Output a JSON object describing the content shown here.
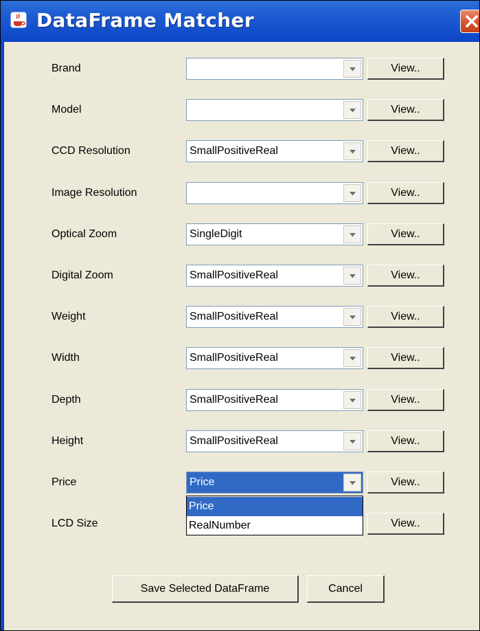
{
  "window": {
    "title": "DataFrame Matcher",
    "icon": "java-cup-icon",
    "close_icon": "close-x-icon"
  },
  "view_label": "View..",
  "fields": [
    {
      "label": "Brand",
      "value": ""
    },
    {
      "label": "Model",
      "value": ""
    },
    {
      "label": "CCD Resolution",
      "value": "SmallPositiveReal"
    },
    {
      "label": "Image Resolution",
      "value": ""
    },
    {
      "label": "Optical Zoom",
      "value": "SingleDigit"
    },
    {
      "label": "Digital Zoom",
      "value": "SmallPositiveReal"
    },
    {
      "label": "Weight",
      "value": "SmallPositiveReal"
    },
    {
      "label": "Width",
      "value": "SmallPositiveReal"
    },
    {
      "label": "Depth",
      "value": "SmallPositiveReal"
    },
    {
      "label": "Height",
      "value": "SmallPositiveReal"
    },
    {
      "label": "Price",
      "value": "Price",
      "open": true
    },
    {
      "label": "LCD Size",
      "value": ""
    }
  ],
  "dropdown": {
    "options": [
      "Price",
      "RealNumber"
    ],
    "highlighted": "Price"
  },
  "buttons": {
    "save": "Save Selected DataFrame",
    "cancel": "Cancel"
  },
  "colors": {
    "titlebar": "#0b46c6",
    "selection": "#316ac5",
    "face": "#ece9d8",
    "close": "#d4502c"
  }
}
